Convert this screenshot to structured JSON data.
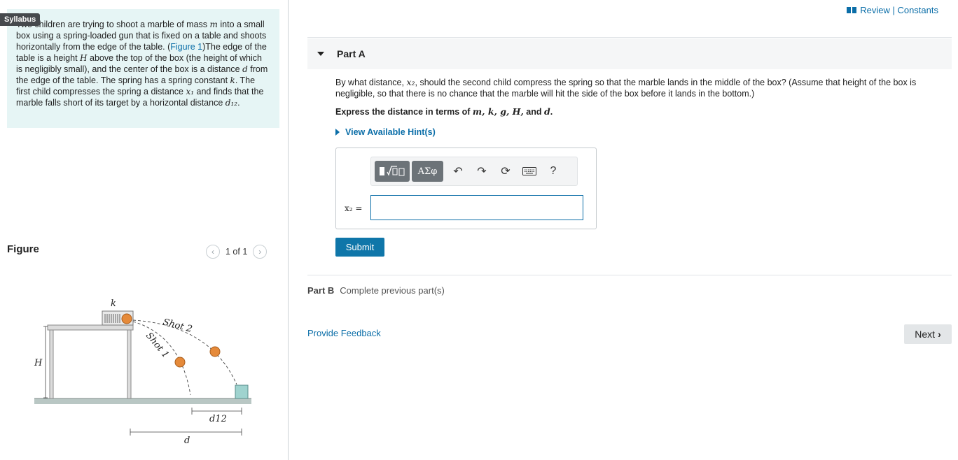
{
  "left": {
    "syllabus_tag": "Syllabus",
    "intro": {
      "p1": "Two children are trying to shoot a marble of mass ",
      "m": "m",
      "p2": " into a small box using a spring-loaded gun that is fixed on a table and shoots horizontally from the edge of the table. (",
      "figure_link": "Figure 1",
      "p3": ")The edge of the table is a height ",
      "H": "H",
      "p4": " above the top of the box (the height of which is negligibly small), and the center of the box is a distance ",
      "d": "d",
      "p5": " from the edge of the table. The spring has a spring constant ",
      "k": "k",
      "p6": ". The first child compresses the spring a distance ",
      "x1": "x₁",
      "p7": " and finds that the marble falls short of its target by a horizontal distance ",
      "d12": "d₁₂",
      "p8": "."
    },
    "figure_title": "Figure",
    "pager": {
      "text": "1 of 1",
      "prev_icon": "chevron-left",
      "next_icon": "chevron-right"
    },
    "figure_labels": {
      "k": "k",
      "shot2": "Shot 2",
      "shot1": "Shot 1",
      "H": "H",
      "d12": "d12",
      "d": "d"
    }
  },
  "right": {
    "review_link": "Review | Constants",
    "partA": {
      "label": "Part A",
      "question_a": "By what distance, ",
      "question_var": "x₂",
      "question_b": ", should the second child compress the spring so that the marble lands in the middle of the box? (Assume that height of the box is negligible, so that there is no chance that the marble will hit the side of the box before it lands in the bottom.)",
      "express_a": "Express the distance in terms of ",
      "express_vars": "m, k, g, H,",
      "express_and": " and ",
      "express_d": "d",
      "express_end": ".",
      "hints": "View Available Hint(s)",
      "toolbar": {
        "greek": "ΑΣφ",
        "help": "?"
      },
      "var_label": "x₂ =",
      "input_value": "",
      "submit": "Submit"
    },
    "partB": {
      "label": "Part B",
      "status": "Complete previous part(s)"
    },
    "feedback": "Provide Feedback",
    "next": "Next"
  }
}
